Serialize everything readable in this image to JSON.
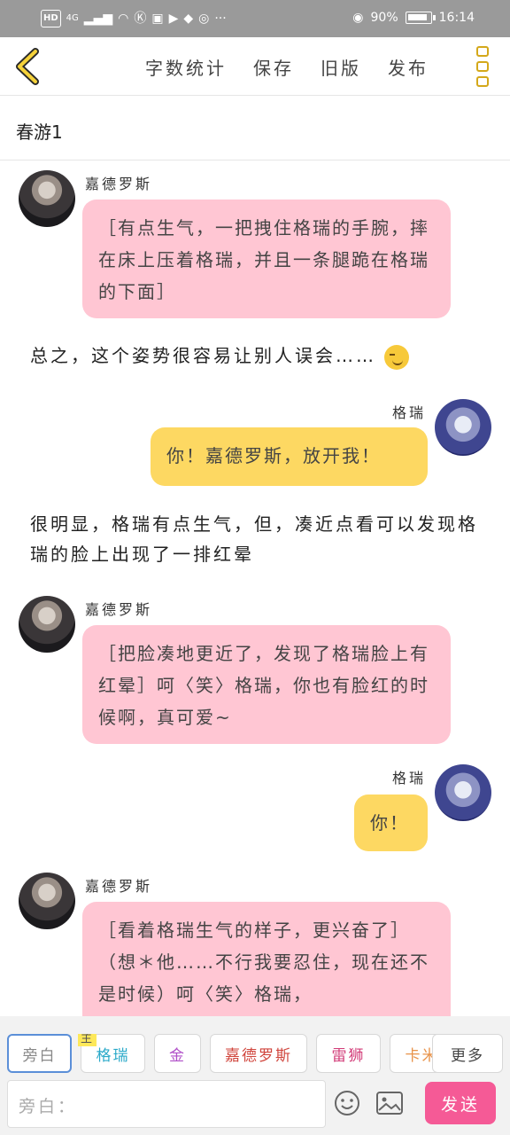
{
  "status": {
    "hd": "HD",
    "network": "4G",
    "battery_percent": "90%",
    "time": "16:14"
  },
  "topbar": {
    "actions": [
      "字数统计",
      "保存",
      "旧版",
      "发布"
    ]
  },
  "story": {
    "title": "春游1"
  },
  "messages": [
    {
      "type": "char",
      "side": "left",
      "name": "嘉德罗斯",
      "text": "［有点生气，一把拽住格瑞的手腕，摔在床上压着格瑞，并且一条腿跪在格瑞的下面］"
    },
    {
      "type": "narr",
      "text": "总之，这个姿势很容易让别人误会……"
    },
    {
      "type": "char",
      "side": "right",
      "name": "格瑞",
      "text": "你！嘉德罗斯，放开我！"
    },
    {
      "type": "narr",
      "text": "很明显，格瑞有点生气，但，凑近点看可以发现格瑞的脸上出现了一排红晕"
    },
    {
      "type": "char",
      "side": "left",
      "name": "嘉德罗斯",
      "text": "［把脸凑地更近了，发现了格瑞脸上有红晕］呵〈笑〉格瑞，你也有脸红的时候啊，真可爱~"
    },
    {
      "type": "char",
      "side": "right",
      "name": "格瑞",
      "text": "你！"
    },
    {
      "type": "char",
      "side": "left",
      "name": "嘉德罗斯",
      "text": "［看着格瑞生气的样子，更兴奋了］（想＊他……不行我要忍住，现在还不是时候）呵〈笑〉格瑞，"
    }
  ],
  "bottom": {
    "roles": [
      {
        "label": "旁白",
        "color": "#888888"
      },
      {
        "label": "格瑞",
        "color": "#2aa9c9",
        "badge": "主"
      },
      {
        "label": "金",
        "color": "#b04fc8"
      },
      {
        "label": "嘉德罗斯",
        "color": "#d0453c"
      },
      {
        "label": "雷狮",
        "color": "#d23c78"
      },
      {
        "label": "卡米",
        "color": "#e8934a"
      }
    ],
    "more_label": "更多",
    "input_placeholder": "旁白：",
    "send_label": "发送"
  }
}
